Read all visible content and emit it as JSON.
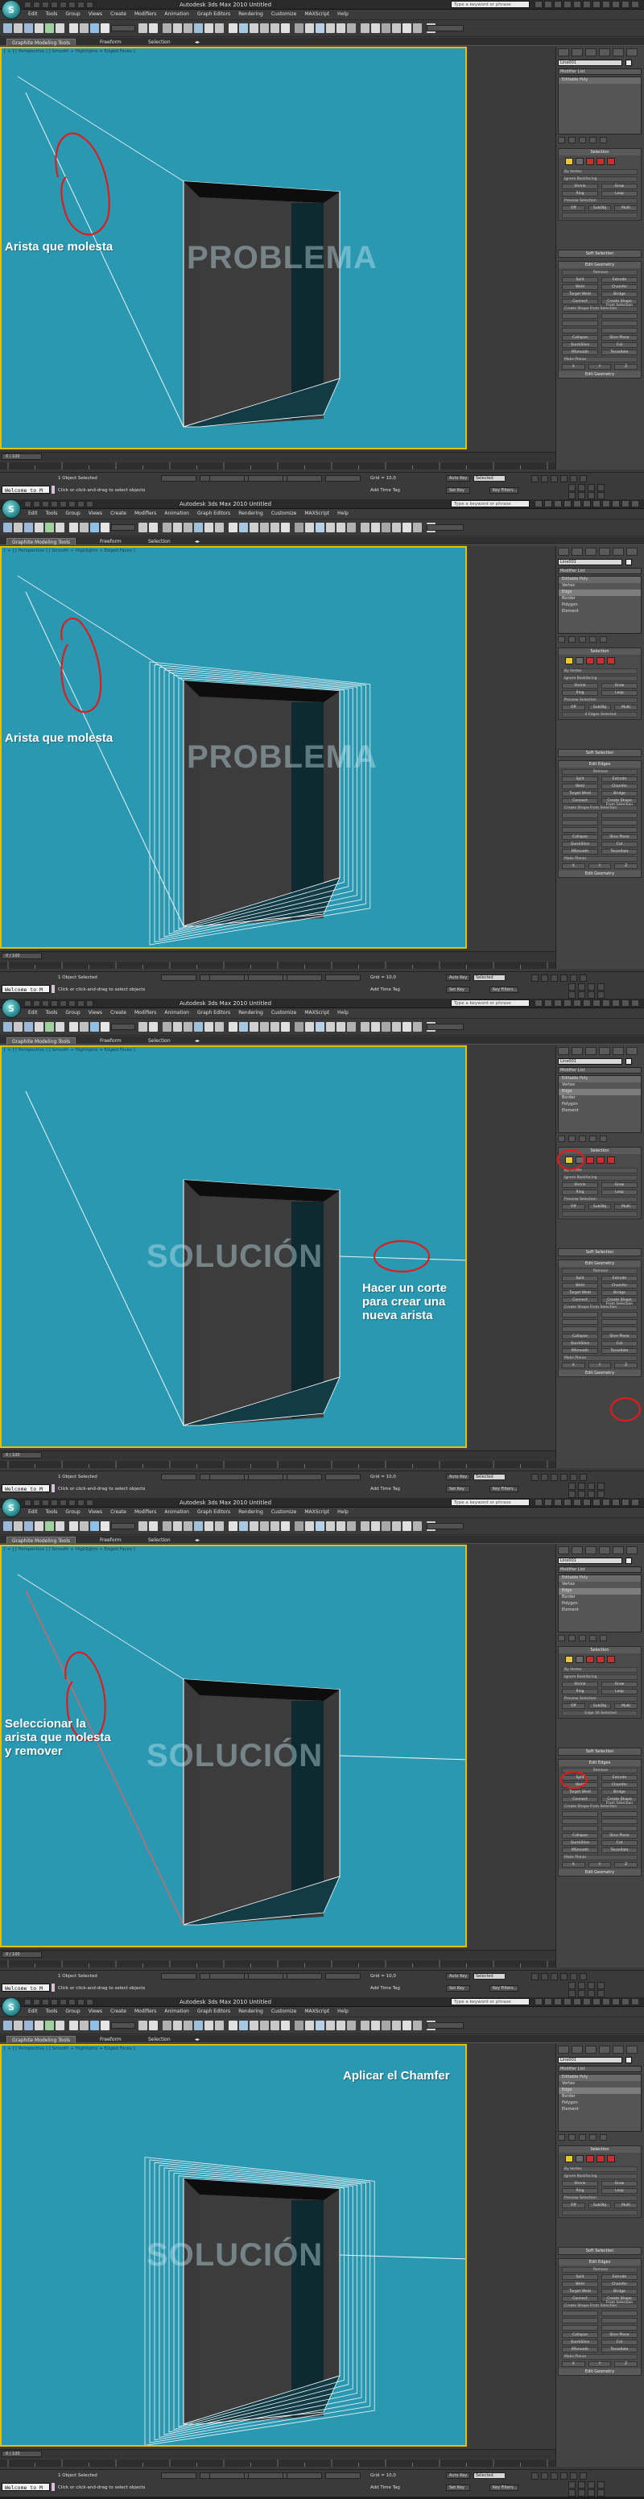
{
  "window": {
    "title": "Autodesk 3ds Max  2010      Untitled",
    "search_placeholder": "Type a keyword or phrase",
    "logo": "3ds-max-logo"
  },
  "menu": [
    "Edit",
    "Tools",
    "Group",
    "Views",
    "Create",
    "Modifiers",
    "Animation",
    "Graph Editors",
    "Rendering",
    "Customize",
    "MAXScript",
    "Help"
  ],
  "ribbon_tabs": [
    "Graphite Modeling Tools",
    "Freeform",
    "Selection"
  ],
  "viewport_label": "[ + ] [ Perspective ] [ Smooth + Highlights + Edged Faces ]",
  "status": {
    "listener": "Welcome to M",
    "selection": "1 Object Selected",
    "prompt": "Click or click-and-drag to select objects",
    "grid": "Grid = 10,0",
    "autokey": "Auto Key",
    "setkey": "Set Key",
    "selected": "Selected",
    "keyfilters": "Key Filters...",
    "addtimetag": "Add Time Tag",
    "frame_counter": "0 / 100"
  },
  "panel": {
    "object_name": "Line001",
    "modifier_list": "Modifier List",
    "rollouts": [
      "Selection",
      "Soft Selection",
      "Edit Edges",
      "Edit Geometry"
    ],
    "buttons": [
      "Remove",
      "Split",
      "Extrude",
      "Weld",
      "Chamfer",
      "Target Weld",
      "Bridge",
      "Connect",
      "Create Shape From Selection"
    ],
    "options": [
      "By Vertex",
      "Ignore Backfacing",
      "Shrink",
      "Grow",
      "Ring",
      "Loop",
      "Preview Selection",
      "Off",
      "SubObj",
      "Multi"
    ],
    "collapse": [
      "Collapse",
      "Slice Plane",
      "Split",
      "QuickSlice",
      "Cut",
      "MSmooth",
      "Tessellate",
      "Make Planar",
      "X",
      "Y",
      "Z"
    ]
  },
  "panels": [
    {
      "watermark": "PROBLEMA",
      "note": "Arista que molesta",
      "stack": [
        "Editable Poly"
      ],
      "selected_stack": -1,
      "selection_info": "",
      "panel_section": "Edit Geometry"
    },
    {
      "watermark": "PROBLEMA",
      "note": "Arista que molesta",
      "stack": [
        "Editable Poly",
        "Vertex",
        "Edge",
        "Border",
        "Polygon",
        "Element"
      ],
      "selected_stack": 2,
      "selection_info": "4 Edges Selected",
      "panel_section": "Edit Edges"
    },
    {
      "watermark": "SOLUCIÓN",
      "note": "Hacer un corte\npara crear una\nnueva arista",
      "stack": [
        "Editable Poly",
        "Vertex",
        "Edge",
        "Border",
        "Polygon",
        "Element"
      ],
      "selected_stack": 2,
      "selection_info": "",
      "panel_section": "Edit Geometry"
    },
    {
      "watermark": "SOLUCIÓN",
      "note": "Seleccionar la\narista que molesta\ny remover",
      "stack": [
        "Editable Poly",
        "Vertex",
        "Edge",
        "Border",
        "Polygon",
        "Element"
      ],
      "selected_stack": 2,
      "selection_info": "Edge 36 Selected",
      "panel_section": "Edit Edges"
    },
    {
      "watermark": "SOLUCIÓN",
      "note": "Aplicar el Chamfer",
      "stack": [
        "Editable Poly",
        "Vertex",
        "Edge",
        "Border",
        "Polygon",
        "Element"
      ],
      "selected_stack": 2,
      "selection_info": "",
      "panel_section": "Edit Edges"
    }
  ],
  "colors": {
    "viewport": "#2b98b2",
    "viewport_border": "#e3c000",
    "annotation": "#dd1d1d",
    "note_text": "#ffffff"
  }
}
